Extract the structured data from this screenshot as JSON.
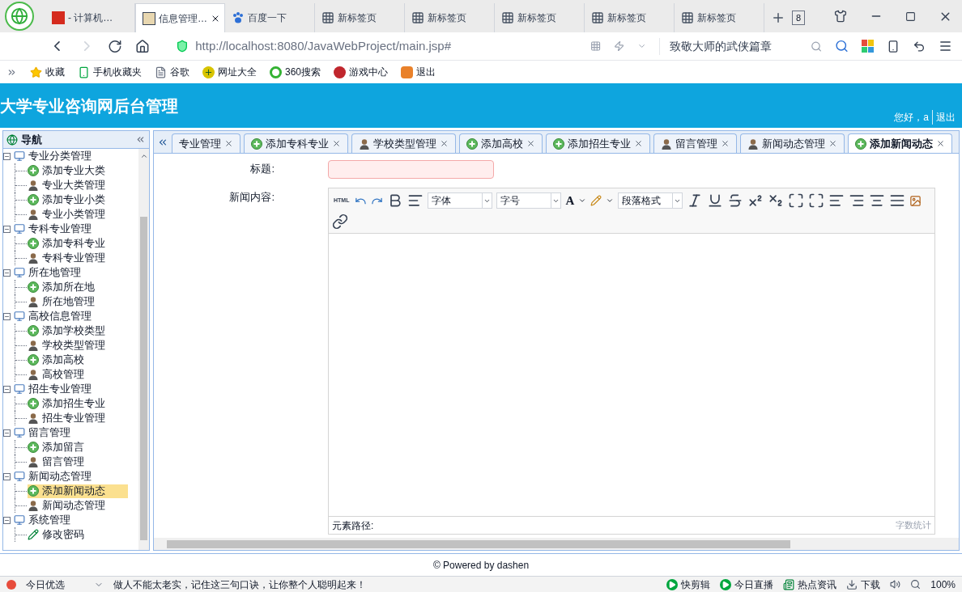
{
  "browser": {
    "tabs": [
      {
        "label": "- 计算机…",
        "kind": "flag",
        "selected": false
      },
      {
        "label": "信息管理…",
        "kind": "app",
        "selected": true
      },
      {
        "label": "百度一下",
        "kind": "paw",
        "selected": false
      },
      {
        "label": "新标签页",
        "kind": "grid",
        "selected": false
      },
      {
        "label": "新标签页",
        "kind": "grid",
        "selected": false
      },
      {
        "label": "新标签页",
        "kind": "grid",
        "selected": false
      },
      {
        "label": "新标签页",
        "kind": "grid",
        "selected": false
      },
      {
        "label": "新标签页",
        "kind": "grid",
        "selected": false
      }
    ],
    "tab_count": "8",
    "address": "http://localhost:8080/JavaWebProject/main.jsp#",
    "search_text": "致敬大师的武侠篇章",
    "bookmarks": [
      {
        "label": "收藏",
        "kind": "star"
      },
      {
        "label": "手机收藏夹",
        "kind": "phone"
      },
      {
        "label": "谷歌",
        "kind": "page"
      },
      {
        "label": "网址大全",
        "kind": "plus"
      },
      {
        "label": "360搜索",
        "kind": "ring"
      },
      {
        "label": "游戏中心",
        "kind": "game"
      },
      {
        "label": "退出",
        "kind": "exit"
      }
    ]
  },
  "header": {
    "title": "大学专业咨询网后台管理",
    "greeting": "您好，a",
    "logout": "退出"
  },
  "nav": {
    "title": "导航",
    "groups": [
      {
        "label": "专业分类管理",
        "expanded": true,
        "children": [
          {
            "label": "添加专业大类",
            "kind": "add",
            "selected": false
          },
          {
            "label": "专业大类管理",
            "kind": "manage",
            "selected": false
          },
          {
            "label": "添加专业小类",
            "kind": "add",
            "selected": false
          },
          {
            "label": "专业小类管理",
            "kind": "manage",
            "selected": false
          }
        ]
      },
      {
        "label": "专科专业管理",
        "expanded": true,
        "children": [
          {
            "label": "添加专科专业",
            "kind": "add",
            "selected": false
          },
          {
            "label": "专科专业管理",
            "kind": "manage",
            "selected": false
          }
        ]
      },
      {
        "label": "所在地管理",
        "expanded": true,
        "children": [
          {
            "label": "添加所在地",
            "kind": "add",
            "selected": false
          },
          {
            "label": "所在地管理",
            "kind": "manage",
            "selected": false
          }
        ]
      },
      {
        "label": "高校信息管理",
        "expanded": true,
        "children": [
          {
            "label": "添加学校类型",
            "kind": "add",
            "selected": false
          },
          {
            "label": "学校类型管理",
            "kind": "manage",
            "selected": false
          },
          {
            "label": "添加高校",
            "kind": "add",
            "selected": false
          },
          {
            "label": "高校管理",
            "kind": "manage",
            "selected": false
          }
        ]
      },
      {
        "label": "招生专业管理",
        "expanded": true,
        "children": [
          {
            "label": "添加招生专业",
            "kind": "add",
            "selected": false
          },
          {
            "label": "招生专业管理",
            "kind": "manage",
            "selected": false
          }
        ]
      },
      {
        "label": "留言管理",
        "expanded": true,
        "children": [
          {
            "label": "添加留言",
            "kind": "add",
            "selected": false
          },
          {
            "label": "留言管理",
            "kind": "manage",
            "selected": false
          }
        ]
      },
      {
        "label": "新闻动态管理",
        "expanded": true,
        "children": [
          {
            "label": "添加新闻动态",
            "kind": "add",
            "selected": true
          },
          {
            "label": "新闻动态管理",
            "kind": "manage",
            "selected": false
          }
        ]
      },
      {
        "label": "系统管理",
        "expanded": true,
        "children": [
          {
            "label": "修改密码",
            "kind": "edit",
            "selected": false
          }
        ]
      }
    ]
  },
  "content_tabs": [
    {
      "label": "专业管理",
      "kind": "none",
      "selected": false
    },
    {
      "label": "添加专科专业",
      "kind": "add",
      "selected": false
    },
    {
      "label": "学校类型管理",
      "kind": "manage",
      "selected": false
    },
    {
      "label": "添加高校",
      "kind": "add",
      "selected": false
    },
    {
      "label": "添加招生专业",
      "kind": "add",
      "selected": false
    },
    {
      "label": "留言管理",
      "kind": "manage",
      "selected": false
    },
    {
      "label": "新闻动态管理",
      "kind": "manage",
      "selected": false
    },
    {
      "label": "添加新闻动态",
      "kind": "add",
      "selected": true
    }
  ],
  "form": {
    "html_button": "HTML",
    "font_color": "A",
    "title_label": "标题:",
    "content_label": "新闻内容:",
    "font_select": "字体",
    "size_select": "字号",
    "paragraph_select": "段落格式",
    "element_path": "元素路径:",
    "word_count": "字数统计"
  },
  "footer": "© Powered by dashen",
  "status_bar": {
    "left": "今日优选",
    "news": "做人不能太老实，记住这三句口诀，让你整个人聪明起来！",
    "items": [
      {
        "label": "快剪辑",
        "kind": "play"
      },
      {
        "label": "今日直播",
        "kind": "play"
      },
      {
        "label": "热点资讯",
        "kind": "news"
      },
      {
        "label": "下载",
        "kind": "download"
      }
    ],
    "zoom": "100%"
  }
}
